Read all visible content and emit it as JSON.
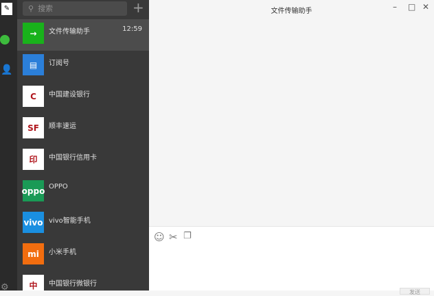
{
  "search": {
    "placeholder": "搜索"
  },
  "chat": {
    "title": "文件传输助手",
    "send_label": "发送"
  },
  "conversations": [
    {
      "name": "文件传输助手",
      "time": "12:59",
      "color": "#19b21b",
      "glyph": "→"
    },
    {
      "name": "订阅号",
      "color": "#2b7fd9",
      "glyph": "▤"
    },
    {
      "name": "中国建设银行",
      "color": "#ffffff",
      "glyph": "C"
    },
    {
      "name": "顺丰速运",
      "color": "#ffffff",
      "glyph": "SF"
    },
    {
      "name": "中国银行信用卡",
      "color": "#ffffff",
      "glyph": "印"
    },
    {
      "name": "OPPO",
      "color": "#1a9a56",
      "glyph": "oppo"
    },
    {
      "name": "vivo智能手机",
      "color": "#1a8fe0",
      "glyph": "vivo"
    },
    {
      "name": "小米手机",
      "color": "#f26d0f",
      "glyph": "mi"
    },
    {
      "name": "中国银行微银行",
      "color": "#ffffff",
      "glyph": "中"
    }
  ]
}
